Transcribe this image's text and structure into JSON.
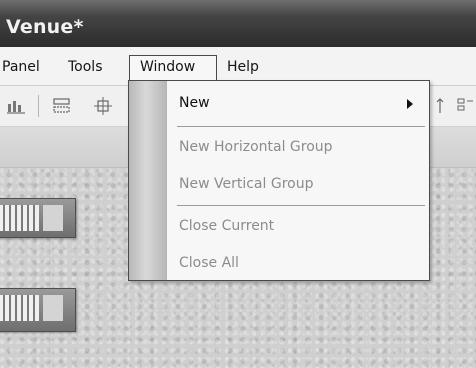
{
  "window": {
    "title": "Venue*"
  },
  "menubar": {
    "items": [
      {
        "label": "Panel"
      },
      {
        "label": "Tools"
      },
      {
        "label": "Window"
      },
      {
        "label": "Help"
      }
    ]
  },
  "window_menu": {
    "items": [
      {
        "label": "New",
        "enabled": true,
        "has_submenu": true
      },
      {
        "label": "New Horizontal Group",
        "enabled": false
      },
      {
        "label": "New Vertical Group",
        "enabled": false
      },
      {
        "label": "Close Current",
        "enabled": false
      },
      {
        "label": "Close All",
        "enabled": false
      }
    ]
  },
  "toolbar": {
    "icons": [
      "distribute-icon",
      "group-icon",
      "align-icon",
      "align-vertical-icon",
      "layout-icon"
    ]
  },
  "canvas": {
    "devices": [
      "rack-device-icon",
      "rack-device-icon"
    ]
  }
}
